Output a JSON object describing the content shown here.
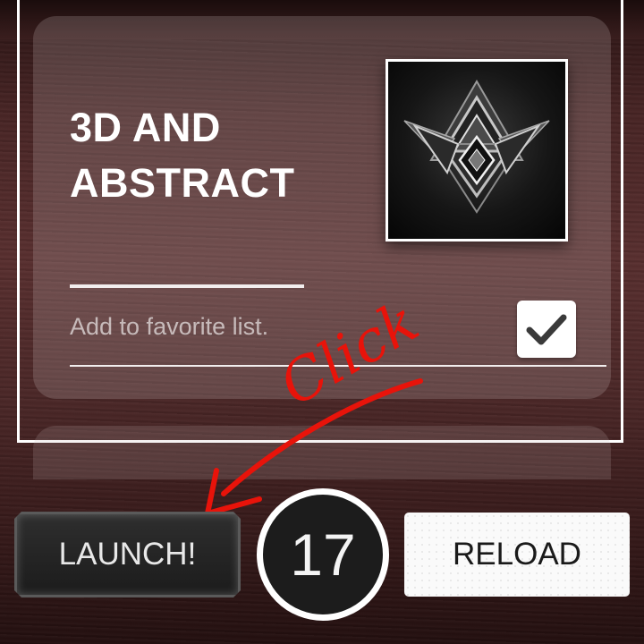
{
  "card": {
    "title_line1": "3D AND",
    "title_line2": "ABSTRACT",
    "favorite_label": "Add to favorite list.",
    "favorite_checked": true
  },
  "annotation": {
    "text": "Click",
    "color": "#e8130a"
  },
  "buttons": {
    "launch_label": "LAUNCH!",
    "reload_label": "RELOAD"
  },
  "counter": {
    "value": "17"
  },
  "icons": {
    "checkbox": "checkmark-icon",
    "thumbnail": "abstract-triangle-artwork"
  }
}
